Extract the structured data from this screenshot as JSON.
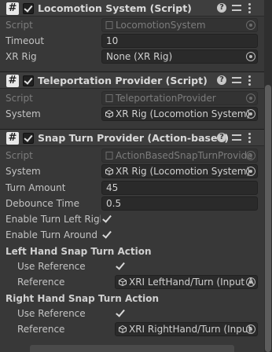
{
  "components": [
    {
      "title": "Locomotion System (Script)",
      "fields": [
        {
          "label": "Script",
          "value": "LocomotionSystem",
          "kind": "script"
        },
        {
          "label": "Timeout",
          "value": "10",
          "kind": "text"
        },
        {
          "label": "XR Rig",
          "value": "None (XR Rig)",
          "kind": "object"
        }
      ]
    },
    {
      "title": "Teleportation Provider (Script)",
      "fields": [
        {
          "label": "Script",
          "value": "TeleportationProvider",
          "kind": "script"
        },
        {
          "label": "System",
          "value": "XR Rig (Locomotion System)",
          "kind": "object"
        }
      ]
    },
    {
      "title": "Snap Turn Provider (Action-based)",
      "fields": [
        {
          "label": "Script",
          "value": "ActionBasedSnapTurnProvide",
          "kind": "script"
        },
        {
          "label": "System",
          "value": "XR Rig (Locomotion System)",
          "kind": "object"
        },
        {
          "label": "Turn Amount",
          "value": "45",
          "kind": "text"
        },
        {
          "label": "Debounce Time",
          "value": "0.5",
          "kind": "text"
        },
        {
          "label": "Enable Turn Left Righ",
          "checked": true,
          "kind": "toggle"
        },
        {
          "label": "Enable Turn Around",
          "checked": true,
          "kind": "toggle"
        }
      ],
      "sections": [
        {
          "heading": "Left Hand Snap Turn Action",
          "use_reference_label": "Use Reference",
          "use_reference": true,
          "reference_label": "Reference",
          "reference_value": "XRI LeftHand/Turn (Input A"
        },
        {
          "heading": "Right Hand Snap Turn Action",
          "use_reference_label": "Use Reference",
          "use_reference": true,
          "reference_label": "Reference",
          "reference_value": "XRI RightHand/Turn (Input"
        }
      ]
    }
  ]
}
